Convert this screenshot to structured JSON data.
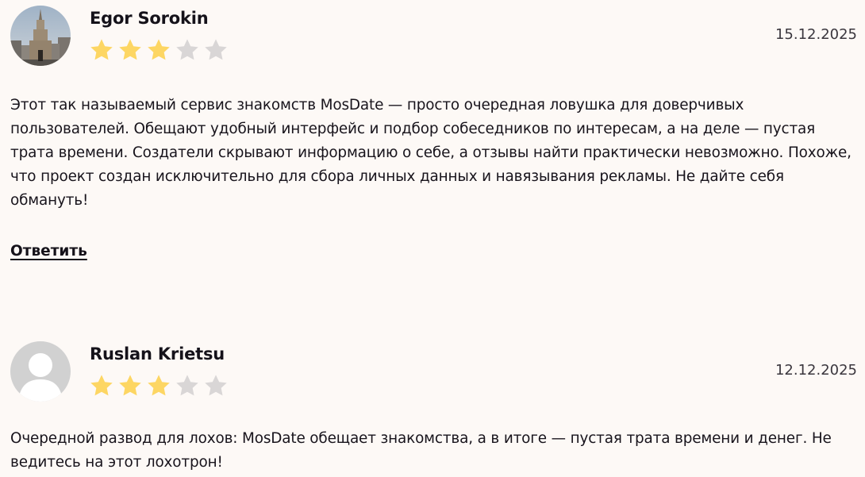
{
  "reviews": [
    {
      "author": "Egor Sorokin",
      "date": "15.12.2025",
      "rating": 3,
      "max_rating": 5,
      "text": "Этот так называемый сервис знакомств MosDate — просто очередная ловушка для доверчивых пользователей. Обещают удобный интерфейс и подбор собеседников по интересам, а на деле — пустая трата времени. Создатели скрывают информацию о себе, а отзывы найти практически невозможно. Похоже, что проект создан исключительно для сбора личных данных и навязывания рекламы. Не дайте себя обмануть!",
      "reply_label": "Ответить"
    },
    {
      "author": "Ruslan Krietsu",
      "date": "12.12.2025",
      "rating": 3,
      "max_rating": 5,
      "text": "Очередной развод для лохов: MosDate обещает знакомства, а в итоге — пустая трата времени и денег. Не ведитесь на этот лохотрон!"
    }
  ],
  "colors": {
    "star_filled": "#fdd663",
    "star_empty": "#d9d6d6",
    "background": "#fdf9f6"
  },
  "icons": {
    "star": "star-icon",
    "default_avatar": "user-silhouette-icon"
  }
}
